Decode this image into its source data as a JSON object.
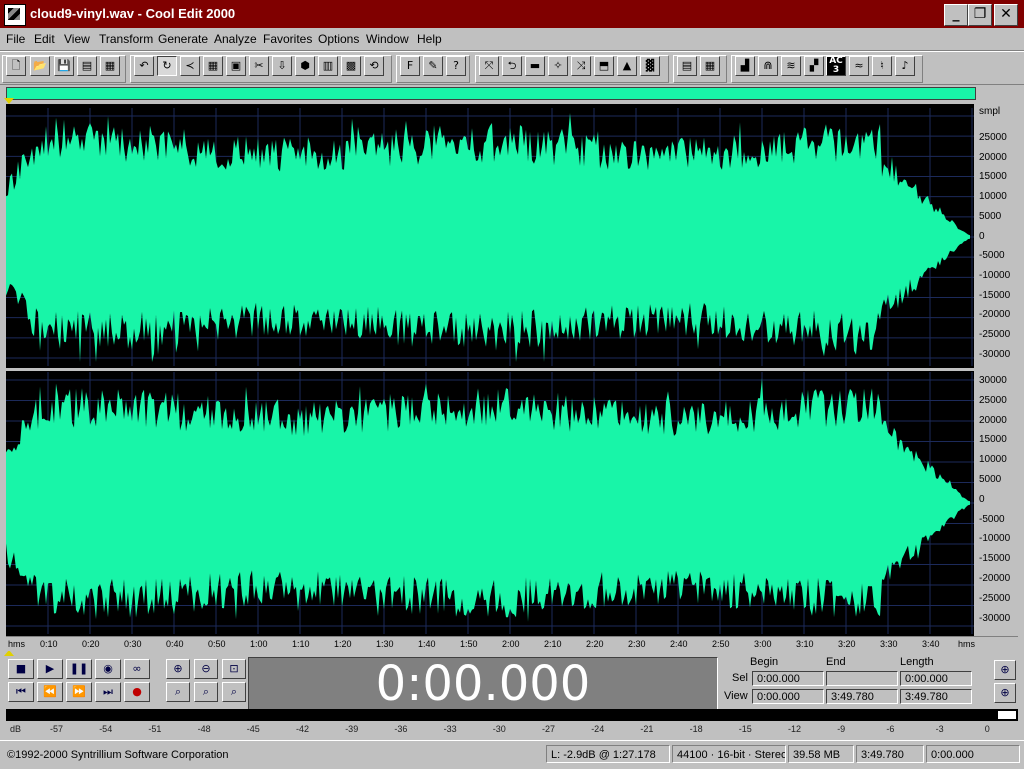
{
  "window": {
    "title": "cloud9-vinyl.wav - Cool Edit 2000"
  },
  "menu": [
    "File",
    "Edit",
    "View",
    "Transform",
    "Generate",
    "Analyze",
    "Favorites",
    "Options",
    "Window",
    "Help"
  ],
  "toolbar": {
    "ac_label": "AC",
    "ac_sub": "3",
    "f_label": "F",
    "help_label": "?"
  },
  "ruler": {
    "unit_top": "smpl",
    "ch1_labels": [
      "25000",
      "20000",
      "15000",
      "10000",
      "5000",
      "0",
      "-5000",
      "-10000",
      "-15000",
      "-20000",
      "-25000",
      "-30000"
    ],
    "ch2_labels": [
      "30000",
      "25000",
      "20000",
      "15000",
      "10000",
      "5000",
      "0",
      "-5000",
      "-10000",
      "-15000",
      "-20000",
      "-25000",
      "-30000"
    ]
  },
  "timeline": {
    "start_label": "hms",
    "end_label": "hms",
    "ticks": [
      "0:10",
      "0:20",
      "0:30",
      "0:40",
      "0:50",
      "1:00",
      "1:10",
      "1:20",
      "1:30",
      "1:40",
      "1:50",
      "2:00",
      "2:10",
      "2:20",
      "2:30",
      "2:40",
      "2:50",
      "3:00",
      "3:10",
      "3:20",
      "3:30",
      "3:40"
    ]
  },
  "display": {
    "time": "0:00.000"
  },
  "selection": {
    "begin_header": "Begin",
    "end_header": "End",
    "length_header": "Length",
    "sel_label": "Sel",
    "view_label": "View",
    "sel_begin": "0:00.000",
    "sel_end": "",
    "sel_length": "0:00.000",
    "view_begin": "0:00.000",
    "view_end": "3:49.780",
    "view_length": "3:49.780"
  },
  "levels": {
    "unit": "dB",
    "ticks": [
      "-57",
      "-54",
      "-51",
      "-48",
      "-45",
      "-42",
      "-39",
      "-36",
      "-33",
      "-30",
      "-27",
      "-24",
      "-21",
      "-18",
      "-15",
      "-12",
      "-9",
      "-6",
      "-3",
      "0"
    ]
  },
  "status": {
    "copyright": "©1992-2000 Syntrillium Software Corporation",
    "level": "L: -2.9dB @   1:27.178",
    "format": "44100 · 16-bit · Stereo",
    "size": "39.58 MB",
    "duration": "3:49.780",
    "free": "0:00.000"
  },
  "colors": {
    "waveform": "#18f5a8",
    "title_bar": "#800000",
    "wave_bg": "#000000"
  }
}
